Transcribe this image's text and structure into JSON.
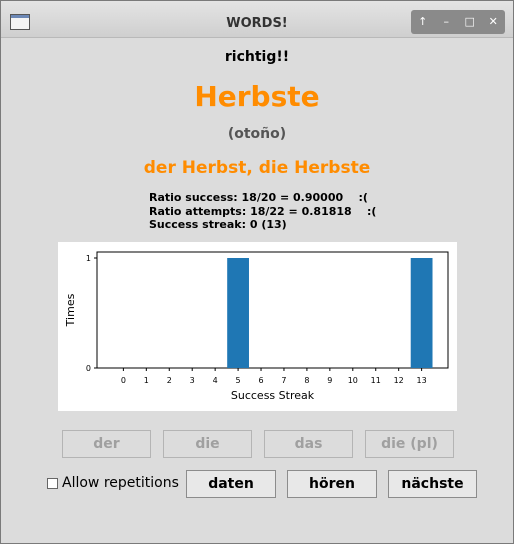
{
  "window": {
    "title": "WORDS!",
    "controls": [
      {
        "name": "up-icon",
        "glyph": "↑"
      },
      {
        "name": "minimize-icon",
        "glyph": "–"
      },
      {
        "name": "maximize-icon",
        "glyph": "□"
      },
      {
        "name": "close-icon",
        "glyph": "✕"
      }
    ]
  },
  "feedback": "richtig!!",
  "word": "Herbste",
  "translation": "(otoño)",
  "forms": "der Herbst, die Herbste",
  "stats": {
    "line1": "Ratio success: 18/20 = 0.90000    :(",
    "line2": "Ratio attempts: 18/22 = 0.81818    :(",
    "line3": "Success streak: 0 (13)"
  },
  "colors": {
    "accent": "#ff8c00",
    "bar": "#1f77b4"
  },
  "chart_data": {
    "type": "bar",
    "categories": [
      "0",
      "1",
      "2",
      "3",
      "4",
      "5",
      "6",
      "7",
      "8",
      "9",
      "10",
      "11",
      "12",
      "13"
    ],
    "values": [
      0,
      0,
      0,
      0,
      0,
      1,
      0,
      0,
      0,
      0,
      0,
      0,
      0,
      1
    ],
    "xlabel": "Success Streak",
    "ylabel": "Times",
    "ylim": [
      0,
      1
    ],
    "yticks": [
      "0",
      "1"
    ]
  },
  "article_buttons": [
    "der",
    "die",
    "das",
    "die (pl)"
  ],
  "allow_repetitions": {
    "label": "Allow repetitions",
    "checked": false
  },
  "actions": {
    "data": "daten",
    "listen": "hören",
    "next": "nächste"
  }
}
